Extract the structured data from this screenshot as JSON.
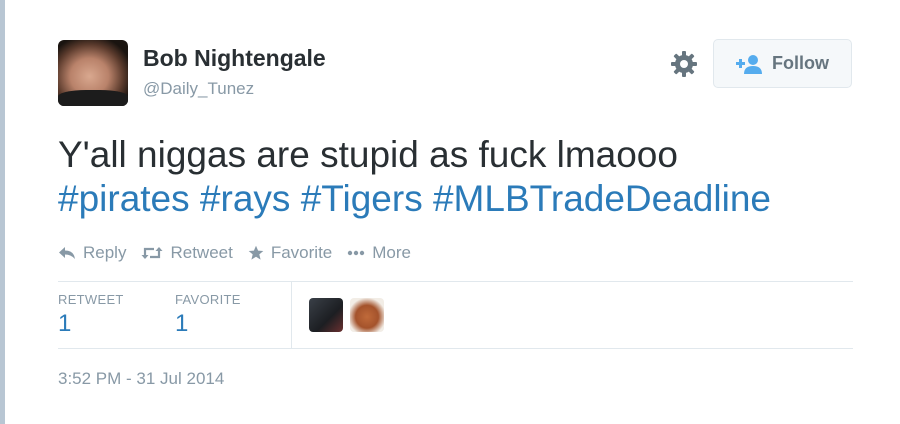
{
  "user": {
    "display_name": "Bob Nightengale",
    "handle": "@Daily_Tunez"
  },
  "follow_button": {
    "label": "Follow"
  },
  "tweet": {
    "text_plain": "Y'all niggas are stupid as fuck lmaooo",
    "hashtags": [
      "#pirates",
      "#rays",
      "#Tigers",
      "#MLBTradeDeadline"
    ]
  },
  "actions": [
    {
      "label": "Reply",
      "icon": "reply-icon"
    },
    {
      "label": "Retweet",
      "icon": "retweet-icon"
    },
    {
      "label": "Favorite",
      "icon": "star-icon"
    },
    {
      "label": "More",
      "icon": "more-dots-icon"
    }
  ],
  "stats": {
    "retweet_label": "RETWEET",
    "retweet_count": "1",
    "favorite_label": "FAVORITE",
    "favorite_count": "1"
  },
  "timestamp": "3:52 PM - 31 Jul 2014",
  "colors": {
    "link": "#2b7bb9",
    "muted": "#8899a6",
    "text": "#292f33"
  }
}
